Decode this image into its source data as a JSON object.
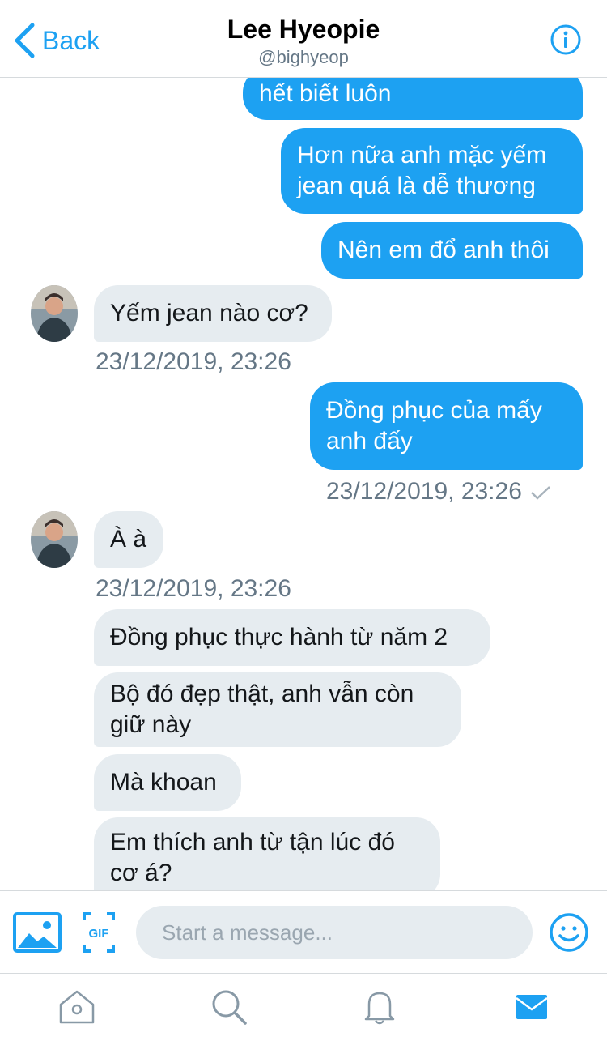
{
  "header": {
    "back_label": "Back",
    "name": "Lee Hyeopie",
    "handle": "@bighyeop"
  },
  "messages": [
    {
      "dir": "out",
      "text": "hết biết luôn"
    },
    {
      "dir": "out",
      "text": "Hơn nữa anh mặc yếm\njean quá là dễ thương"
    },
    {
      "dir": "out",
      "text": "Nên em đổ anh thôi"
    },
    {
      "dir": "in",
      "text": "Yếm jean nào cơ?"
    },
    {
      "dir": "out",
      "text": "Đồng phục của mấy\nanh đấy"
    },
    {
      "dir": "in",
      "text": "À à"
    },
    {
      "dir": "in",
      "text": "Đồng phục thực hành từ năm 2"
    },
    {
      "dir": "in",
      "text": "Bộ đó đẹp thật, anh vẫn còn\ngiữ này"
    },
    {
      "dir": "in",
      "text": "Mà khoan"
    },
    {
      "dir": "in",
      "text": "Em thích anh từ tận lúc đó\ncơ á?"
    }
  ],
  "timestamps": [
    "23/12/2019, 23:26",
    "23/12/2019, 23:26",
    "23/12/2019, 23:26"
  ],
  "composer": {
    "placeholder": "Start a message..."
  },
  "icons": {
    "back": "chevron-left-icon",
    "info": "info-icon",
    "image": "image-icon",
    "gif": "gif-icon",
    "emoji": "emoji-icon",
    "home": "home-icon",
    "search": "search-icon",
    "notifications": "bell-icon",
    "messages": "mail-icon",
    "read": "checkmark-icon"
  },
  "colors": {
    "accent": "#1da1f2",
    "incoming_bubble": "#e6ecf0",
    "muted": "#657786"
  }
}
